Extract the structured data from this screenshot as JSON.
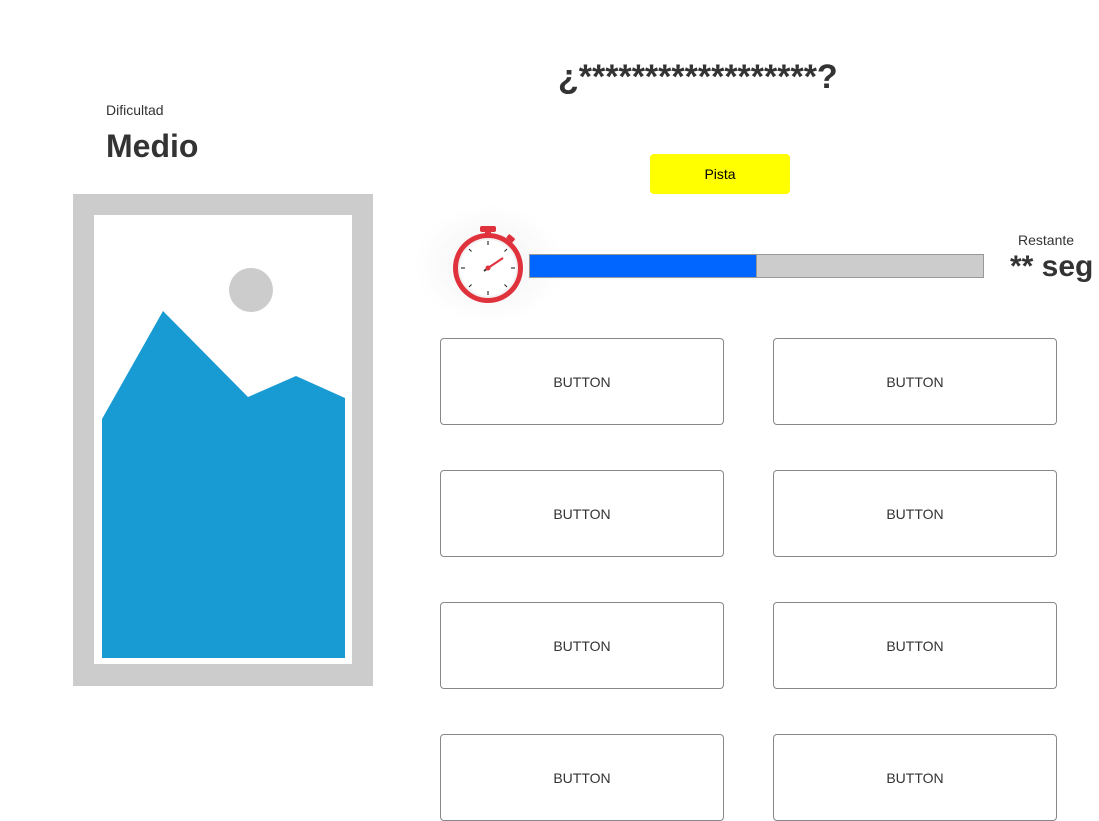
{
  "difficulty": {
    "label": "Dificultad",
    "value": "Medio"
  },
  "question": {
    "text": "¿******************?"
  },
  "hint_button": {
    "label": "Pista",
    "color": "#ffff00"
  },
  "timer": {
    "icon": "stopwatch-icon",
    "progress_fraction": 0.5,
    "fill_color": "#0066ff",
    "track_color": "#cccccc",
    "remaining_label": "Restante",
    "remaining_value": "** seg"
  },
  "image_placeholder": {
    "icon": "image-placeholder-icon",
    "accent": "#189ad3"
  },
  "answers": [
    {
      "label": "BUTTON"
    },
    {
      "label": "BUTTON"
    },
    {
      "label": "BUTTON"
    },
    {
      "label": "BUTTON"
    },
    {
      "label": "BUTTON"
    },
    {
      "label": "BUTTON"
    },
    {
      "label": "BUTTON"
    },
    {
      "label": "BUTTON"
    }
  ]
}
